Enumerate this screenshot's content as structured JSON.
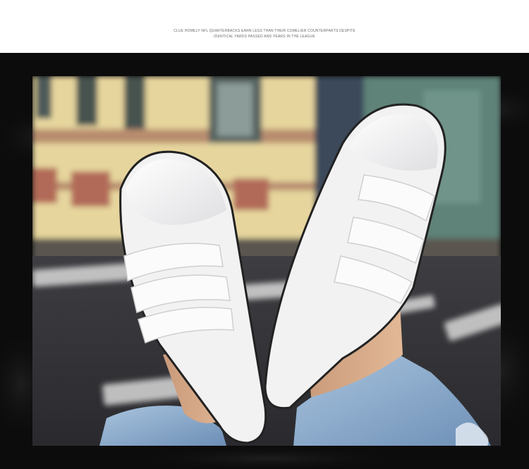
{
  "caption": {
    "line1": "CLUE HOMELY NFL QUARTERBACKS EARN LESS THAN THEIR COMELIER COUNTERPARTS DESPITE",
    "line2": "IDENTICAL YARDS PASSED AND YEARS IN THE LEAGUE"
  },
  "photo": {
    "subject": "white-velcro-canvas-sneakers",
    "icon": "photo-image"
  },
  "colors": {
    "frame": "#0c0c0c",
    "background": "#ffffff",
    "caption_text": "#6a6a6a"
  }
}
